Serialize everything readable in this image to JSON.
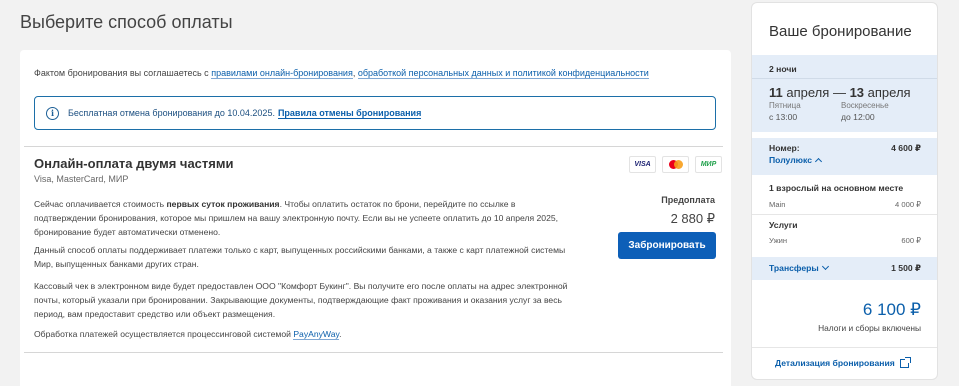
{
  "page_title": "Выберите способ оплаты",
  "agreement": {
    "prefix": "Фактом бронирования вы соглашаетесь с",
    "link1": "правилами онлайн-бронирования",
    "sep": ",",
    "link2": "обработкой персональных данных и политикой конфиденциальности"
  },
  "cancellation": {
    "text": "Бесплатная отмена бронирования до 10.04.2025.",
    "link": "Правила отмены бронирования",
    "icon": "info-icon"
  },
  "payment_option": {
    "title": "Онлайн-оплата двумя частями",
    "subtitle": "Visa, MasterCard, МИР",
    "icons": [
      "VISA",
      "mastercard",
      "МИР"
    ],
    "p1_a": "Сейчас оплачивается стоимость",
    "p1_bold": "первых суток проживания",
    "p1_b": ". Чтобы оплатить остаток по брони, перейдите по ссылке в подтверждении бронирования, которое мы пришлем на вашу электронную почту. Если вы не успеете оплатить до 10 апреля 2025, бронирование будет автоматически отменено.",
    "p2": "Данный способ оплаты поддерживает платежи только с карт, выпущенных российскими банками, а также с карт платежной системы Мир, выпущенных банками других стран.",
    "p3": "Кассовый чек в электронном виде будет предоставлен ООО \"Комфорт Букинг\". Вы получите его после оплаты на адрес электронной почты, который указали при бронировании. Закрывающие документы, подтверждающие факт проживания и оказания услуг за весь период, вам предоставит средство или объект размещения.",
    "p4_a": "Обработка платежей осуществляется процессинговой системой",
    "p4_link": "PayAnyWay",
    "p4_b": ".",
    "prepay_label": "Предоплата",
    "prepay_value": "2 880 ₽",
    "book_button": "Забронировать"
  },
  "sidebar": {
    "title": "Ваше бронирование",
    "nights": "2 ночи",
    "checkin_day": "11",
    "checkin_month": "апреля",
    "dash": "—",
    "checkout_day": "13",
    "checkout_month": "апреля",
    "checkin_weekday": "Пятница",
    "checkin_time": "с 13:00",
    "checkout_weekday": "Воскресенье",
    "checkout_time": "до 12:00",
    "room_label": "Номер:",
    "room_price": "4 600 ₽",
    "room_name": "Полулюкс",
    "guests_label": "1 взрослый на основном месте",
    "main_label": "Main",
    "main_price": "4 000 ₽",
    "services_label": "Услуги",
    "dinner_label": "Ужин",
    "dinner_price": "600 ₽",
    "transfers_label": "Трансферы",
    "transfers_price": "1 500 ₽",
    "total": "6 100 ₽",
    "total_note": "Налоги и сборы включены",
    "details_link": "Детализация бронирования"
  },
  "colors": {
    "accent": "#0d5fb8",
    "link": "#0b5fab",
    "sidebar_band": "#e4edf8",
    "background": "#f2f2f2"
  }
}
